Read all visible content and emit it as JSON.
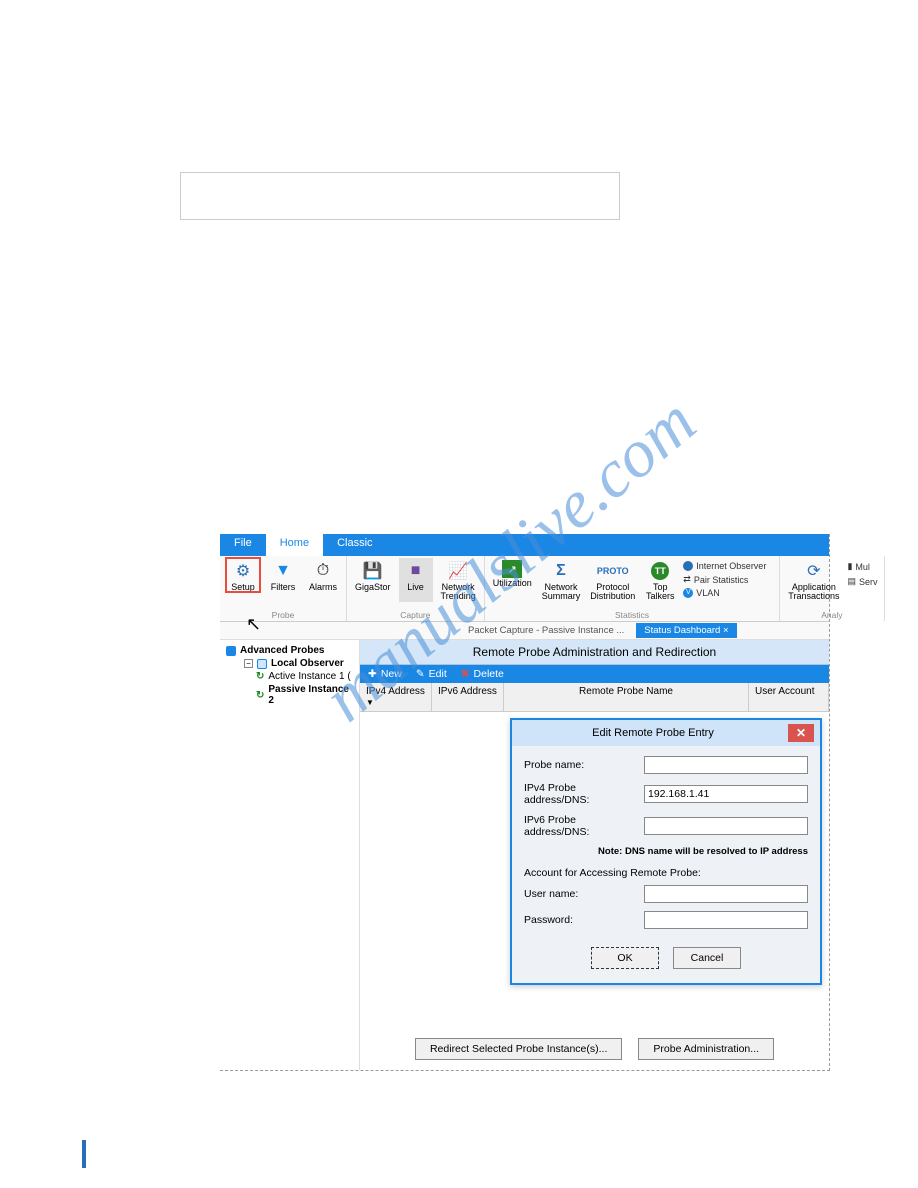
{
  "watermark": "manualslive.com",
  "tabbar": {
    "file": "File",
    "home": "Home",
    "classic": "Classic"
  },
  "ribbon": {
    "setup": "Setup",
    "filters": "Filters",
    "alarms": "Alarms",
    "gigastor": "GigaStor",
    "live": "Live",
    "trending": "Network\nTrending",
    "utilization": "Utilization",
    "summary": "Network\nSummary",
    "protocol": "Protocol\nDistribution",
    "talkers": "Top\nTalkers",
    "apptrans": "Application\nTransactions",
    "mul": "Mul",
    "serv": "Serv",
    "internet": "Internet Observer",
    "pair": "Pair Statistics",
    "vlan": "VLAN",
    "grp_probe": "Probe",
    "grp_capture": "Capture",
    "grp_stats": "Statistics",
    "grp_analy": "Analy"
  },
  "doctabs": {
    "pc": "Packet Capture - Passive Instance ...",
    "status": "Status Dashboard",
    "x": "×"
  },
  "tree": {
    "advanced": "Advanced Probes",
    "local": "Local Observer",
    "active": "Active Instance 1 (",
    "passive": "Passive Instance 2"
  },
  "panel": {
    "title": "Remote Probe Administration and Redirection",
    "new": "New",
    "edit": "Edit",
    "delete": "Delete",
    "col_ipv4": "IPv4 Address",
    "col_ipv6": "IPv6 Address",
    "col_name": "Remote Probe Name",
    "col_user": "User Account"
  },
  "dialog": {
    "title": "Edit Remote Probe Entry",
    "probe_name": "Probe name:",
    "ipv4": "IPv4 Probe address/DNS:",
    "ipv4_val": "192.168.1.41",
    "ipv6": "IPv6 Probe address/DNS:",
    "note": "Note: DNS name will be resolved to IP address",
    "acct": "Account for Accessing Remote Probe:",
    "user": "User name:",
    "pass": "Password:",
    "ok": "OK",
    "cancel": "Cancel"
  },
  "footer": {
    "redirect": "Redirect Selected Probe Instance(s)...",
    "admin": "Probe Administration..."
  }
}
